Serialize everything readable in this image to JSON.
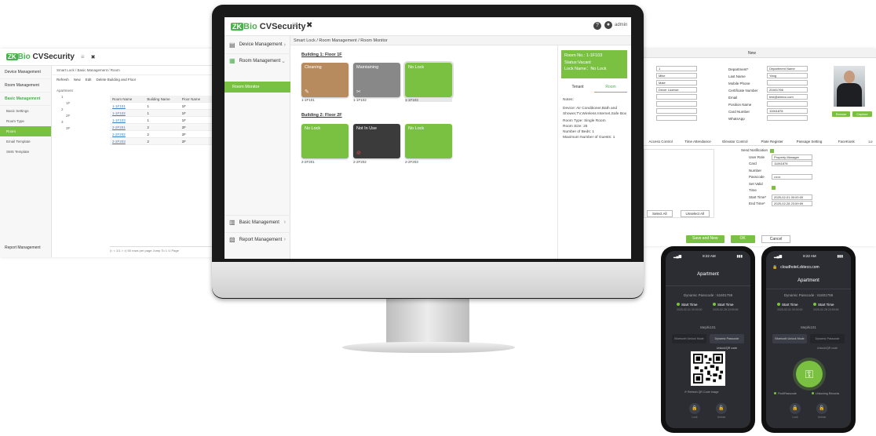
{
  "left_screen": {
    "logo": {
      "zk": "ZK",
      "bio": "Bio",
      "rest": " CVSecurity"
    },
    "menu_icon": "≡",
    "close_icon": "✖",
    "sidebar": {
      "items": [
        "Device Management",
        "Room Management",
        "Basic Management"
      ],
      "subitems": [
        "Basic Settings",
        "Room Type",
        "Room",
        "Email Template",
        "SMS Template"
      ],
      "footer": "Report Management"
    },
    "breadcrumb": "Smart Lock / Basic Management / Room",
    "toolbar": [
      "Refresh",
      "New",
      "Edit",
      "Delete Building and Floor"
    ],
    "tree": [
      "Apartment",
      "1",
      "1F",
      "2",
      "2F",
      "3",
      "3F"
    ],
    "table": {
      "headers": [
        "Room Name",
        "Building Name",
        "Floor Name"
      ],
      "rows": [
        [
          "1-1F101",
          "1",
          "1F"
        ],
        [
          "1-1F102",
          "1",
          "1F"
        ],
        [
          "1-1F103",
          "1",
          "1F"
        ],
        [
          "2-2F201",
          "2",
          "2F"
        ],
        [
          "2-2F202",
          "2",
          "2F"
        ],
        [
          "2-2F203",
          "2",
          "2F"
        ]
      ]
    },
    "pager": "|< < 1/1 > >|   50 rows per page   Jump To 1 /1 Page"
  },
  "right_screen": {
    "title": "New",
    "left_fields": [
      "1",
      "Mike",
      "Male",
      "Driver License",
      "",
      "",
      "",
      ""
    ],
    "right_labels": [
      "Department*",
      "Last Name",
      "Mobile Phone",
      "Certificate Number",
      "Email",
      "Position Name",
      "Card Number",
      "WhatsApp"
    ],
    "right_values": [
      "Department Name",
      "Yang",
      "",
      "20401766",
      "test@zkteco.com",
      "",
      "11061878",
      ""
    ],
    "photo_buttons": [
      "Browse",
      "Capture"
    ],
    "tabs": [
      "Access Control",
      "Time Attendance",
      "Elevator Control",
      "Plate Register",
      "Passage Setting",
      "FaceKiosk",
      "Lo"
    ],
    "send_notification": "Send Notification",
    "lock_fields": [
      {
        "label": "User Role",
        "value": "Property Manager"
      },
      {
        "label": "Card Number",
        "value": "11061878"
      },
      {
        "label": "Passcode",
        "value": "••••••"
      },
      {
        "label": "Set Valid Time",
        "value": ""
      },
      {
        "label": "Start Time*",
        "value": "2025-02-01 00:00:00"
      },
      {
        "label": "End Time*",
        "value": "2025-02-28 23:59:59"
      }
    ],
    "select_all": "Select All",
    "unselect_all": "Unselect All",
    "buttons": [
      "Save and New",
      "OK",
      "Cancel"
    ]
  },
  "monitor_app": {
    "logo": {
      "zk": "ZK",
      "bio": "Bio",
      "rest": " CVSecurity"
    },
    "menu_icon": "≡",
    "close_icon": "✖",
    "help_icon": "?",
    "user": "admin",
    "sidebar": {
      "device": "Device Management",
      "room": "Room Management",
      "room_monitor": "Room Monitor",
      "basic": "Basic Management",
      "report": "Report Management"
    },
    "breadcrumb": "Smart Lock / Room Management / Room Monitor",
    "buildings": [
      {
        "title": "Building 1:  Floor 1F",
        "rooms": [
          {
            "status": "Cleaning",
            "name": "1-1F101",
            "color": "#b88b5e",
            "icon": "✎"
          },
          {
            "status": "Maintaining",
            "name": "1-1F102",
            "color": "#888888",
            "icon": "✂"
          },
          {
            "status": "No Lock",
            "name": "1-1F103",
            "color": "#7ac142",
            "icon": ""
          }
        ]
      },
      {
        "title": "Building 2:  Floor 2F",
        "rooms": [
          {
            "status": "No Lock",
            "name": "2-2F201",
            "color": "#7ac142",
            "icon": ""
          },
          {
            "status": "Not In Use",
            "name": "2-2F202",
            "color": "#3b3b3b",
            "icon": "⊘"
          },
          {
            "status": "No Lock",
            "name": "2-2F203",
            "color": "#7ac142",
            "icon": ""
          }
        ]
      }
    ],
    "detail": {
      "room_no": "Room No.: 1-1F103",
      "status": "Status:Vacant",
      "lock_name": "Lock Name：No Lock",
      "tabs": [
        "Tenant",
        "Room"
      ],
      "notes": "Notes:",
      "device": "Device:  Air Conditioner,Bath and Shower,TV,Wireless Internet,Safe Box",
      "room_type": "Room Type:  Single Room",
      "room_size": "Room Size:  25",
      "beds": "Number of Beds:  1",
      "guests": "Maximum Number of Guests:  1"
    }
  },
  "phone_left": {
    "time": "8:22 AM",
    "battery": "▮▮▮",
    "title": "Apartment",
    "passcode": "Dynamic Passcode : 61601759",
    "start_label": "Start Time",
    "end_label": "Start Time",
    "start_sub": "2025-02-01 00:00:00",
    "end_sub": "2025-02-28 23:59:59",
    "room": "Mephi101",
    "btn_left": "Bluetooth Unlock Mode",
    "btn_right": "Dynamic Passcode Unlock/QR code",
    "refresh": "⟳  Refresh QR Code Image",
    "foot_left": "Lock",
    "foot_right": "Unlock"
  },
  "phone_right": {
    "time": "8:22 AM",
    "battery": "▮▮▮",
    "url": "cloudhotel.zkteco.com",
    "title": "Apartment",
    "passcode": "Dynamic Passcode : 61601759",
    "start_label": "Start Time",
    "end_label": "Start Time",
    "start_sub": "2025-02-01 00:00:00",
    "end_sub": "2025-02-28 23:59:59",
    "room": "Mephi101",
    "btn_left": "Bluetooth Unlock Mode",
    "btn_right": "Dynamic Passcode Unlock/QR code",
    "status_left": "Find/Passcode",
    "status_right": "Unlocking Records",
    "foot_left": "Lock",
    "foot_right": "Unlock"
  }
}
